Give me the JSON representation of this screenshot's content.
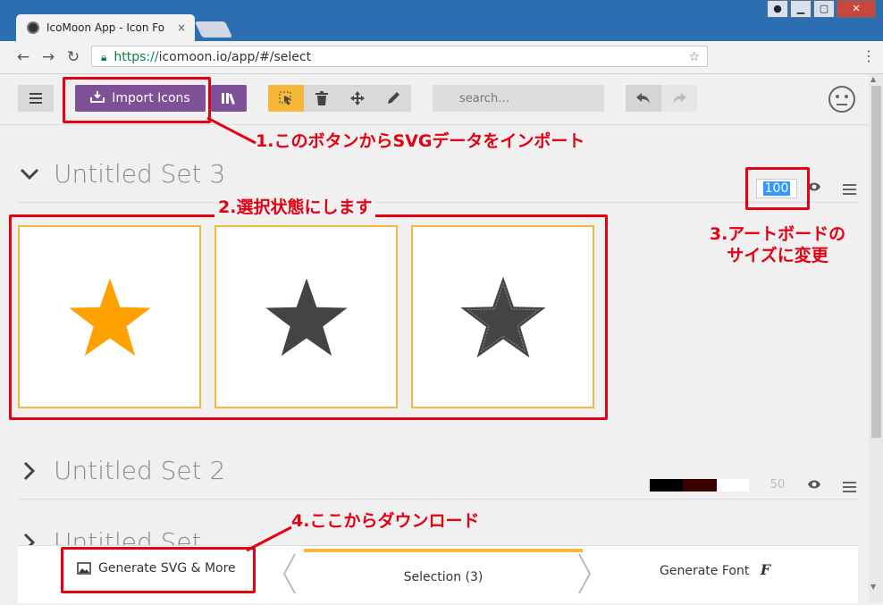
{
  "browser": {
    "tab_title": "IcoMoon App - Icon Fo",
    "tab_close": "×",
    "url_protocol": "https://",
    "url_rest": "icomoon.io/app/#/select",
    "window_close": "✕"
  },
  "toolbar": {
    "import_label": "Import Icons",
    "search_placeholder": "search…"
  },
  "sets": [
    {
      "title": "Untitled Set 3",
      "size": "100",
      "expanded": true
    },
    {
      "title": "Untitled Set 2",
      "size": "50",
      "expanded": false,
      "colors": [
        "#000000",
        "#3a0000",
        "#ffffff"
      ]
    },
    {
      "title": "Untitled Set",
      "expanded": false
    }
  ],
  "icons": [
    {
      "name": "star",
      "color": "#ffa100"
    },
    {
      "name": "star",
      "color": "#444444"
    },
    {
      "name": "star-stitched",
      "color": "#444444"
    }
  ],
  "bottombar": {
    "generate_svg": "Generate SVG & More",
    "selection": "Selection (3)",
    "generate_font": "Generate Font",
    "font_glyph": "F"
  },
  "annotations": {
    "note1": "1.このボタンからSVGデータをインポート",
    "note2": "2.選択状態にします",
    "note3_line1": "3.アートボードの",
    "note3_line2": "サイズに変更",
    "note4": "4.ここからダウンロード"
  },
  "colors": {
    "accent_purple": "#7f4f97",
    "accent_yellow": "#f6b83a",
    "annotation_red": "#e50012"
  }
}
